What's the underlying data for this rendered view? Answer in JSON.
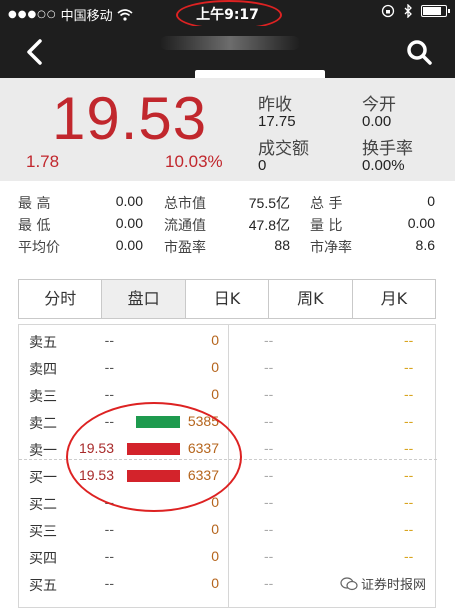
{
  "status": {
    "carrier": "中国移动",
    "time": "上午9:17",
    "battery_level": 0.85
  },
  "quote": {
    "price": "19.53",
    "change": "1.78",
    "change_pct": "10.03%",
    "prev_close_label": "昨收",
    "prev_close": "17.75",
    "open_label": "今开",
    "open": "0.00",
    "turnover_label": "成交额",
    "turnover": "0",
    "turnover_rate_label": "换手率",
    "turnover_rate": "0.00%"
  },
  "stats": [
    {
      "label": "最 高",
      "value": "0.00",
      "label2": "总市值",
      "value2": "75.5亿",
      "label3": "总 手",
      "value3": "0"
    },
    {
      "label": "最 低",
      "value": "0.00",
      "label2": "流通值",
      "value2": "47.8亿",
      "label3": "量 比",
      "value3": "0.00"
    },
    {
      "label": "平均价",
      "value": "0.00",
      "label2": "市盈率",
      "value2": "88",
      "label3": "市净率",
      "value3": "8.6"
    }
  ],
  "tabs": [
    "分时",
    "盘口",
    "日K",
    "周K",
    "月K"
  ],
  "active_tab": "盘口",
  "order_book": [
    {
      "name": "卖五",
      "price": "--",
      "volume": "0"
    },
    {
      "name": "卖四",
      "price": "--",
      "volume": "0"
    },
    {
      "name": "卖三",
      "price": "--",
      "volume": "0"
    },
    {
      "name": "卖二",
      "price": "--",
      "volume": "5385"
    },
    {
      "name": "卖一",
      "price": "19.53",
      "volume": "6337"
    },
    {
      "name": "买一",
      "price": "19.53",
      "volume": "6337"
    },
    {
      "name": "买二",
      "price": "--",
      "volume": "0"
    },
    {
      "name": "买三",
      "price": "--",
      "volume": "0"
    },
    {
      "name": "买四",
      "price": "--",
      "volume": "0"
    },
    {
      "name": "买五",
      "price": "--",
      "volume": "0"
    }
  ],
  "right_placeholder": "--",
  "watermark": "证券时报网",
  "colors": {
    "up": "#c1272d",
    "bar_red": "#d3232b",
    "bar_green": "#1e9a4e",
    "navbar": "#1e1e1e",
    "annotation": "#dd2222"
  }
}
